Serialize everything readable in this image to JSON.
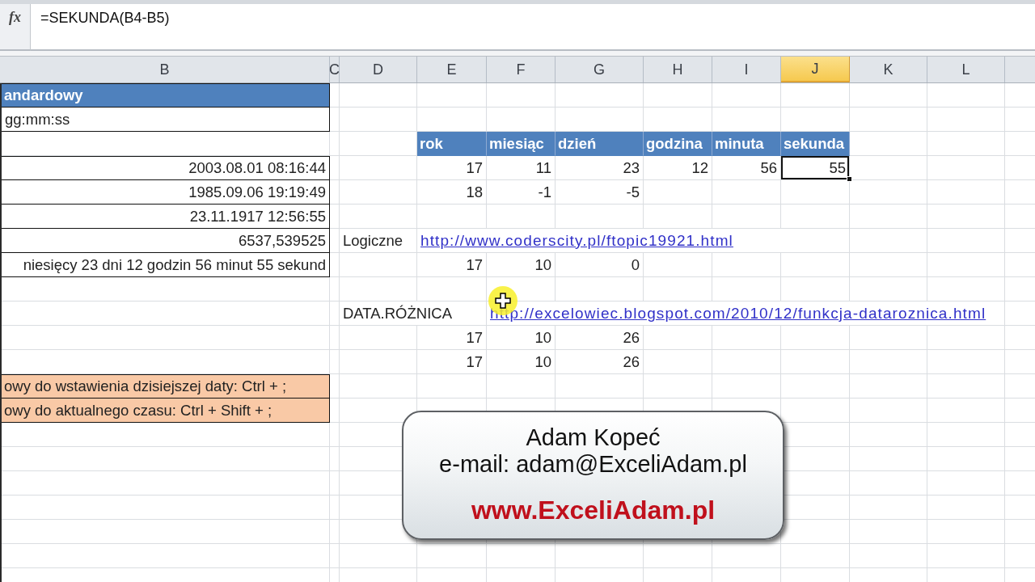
{
  "formula_bar": {
    "function_button": "fx",
    "formula": "=SEKUNDA(B4-B5)"
  },
  "column_headers": [
    {
      "label": "B",
      "selected": false
    },
    {
      "label": "C",
      "selected": false
    },
    {
      "label": "D",
      "selected": false
    },
    {
      "label": "E",
      "selected": false
    },
    {
      "label": "F",
      "selected": false
    },
    {
      "label": "G",
      "selected": false
    },
    {
      "label": "H",
      "selected": false
    },
    {
      "label": "I",
      "selected": false
    },
    {
      "label": "J",
      "selected": true
    },
    {
      "label": "K",
      "selected": false
    },
    {
      "label": "L",
      "selected": false
    }
  ],
  "date_formats_table": {
    "title": "andardowy",
    "format": "gg:mm:ss",
    "values": [
      "2003.08.01 08:16:44",
      "1985.09.06 19:19:49",
      "23.11.1917 12:56:55",
      "6537,539525",
      "niesięcy 23 dni 12 godzin 56 minut 55 sekund"
    ]
  },
  "date_parts_table": {
    "columns": [
      "rok",
      "miesiąc",
      "dzień",
      "godzina",
      "minuta",
      "sekunda"
    ],
    "rows": [
      [
        {
          "value": "17",
          "selected": false
        },
        {
          "value": "11",
          "selected": false
        },
        {
          "value": "23",
          "selected": false
        },
        {
          "value": "12",
          "selected": false
        },
        {
          "value": "56",
          "selected": false
        },
        {
          "value": "55",
          "selected": true
        }
      ],
      [
        {
          "value": "18",
          "selected": false
        },
        {
          "value": "-1",
          "selected": false
        },
        {
          "value": "-5",
          "selected": false
        }
      ]
    ]
  },
  "link_sections": [
    {
      "label": "Logiczne",
      "link": "http://www.coderscity.pl/ftopic19921.html",
      "rows": [
        [
          "17",
          "10",
          "0"
        ]
      ]
    },
    {
      "label": "DATA.RÓŻNICA",
      "link": "http://excelowiec.blogspot.com/2010/12/funkcja-dataroznica.html",
      "rows": [
        [
          "17",
          "10",
          "26"
        ],
        [
          "17",
          "10",
          "26"
        ]
      ]
    }
  ],
  "shortcut_notes": [
    "owy do wstawienia dzisiejszej daty: Ctrl + ;",
    "owy do aktualnego czasu: Ctrl + Shift + ;"
  ],
  "contact_card": {
    "name": "Adam Kopeć",
    "email": "e-mail: adam@ExceliAdam.pl",
    "website": "www.ExceliAdam.pl"
  }
}
